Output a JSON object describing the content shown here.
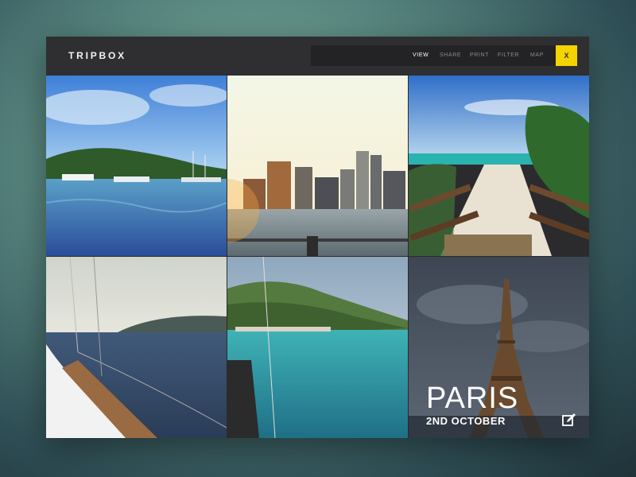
{
  "app": {
    "name": "TRIPBOX"
  },
  "menu": {
    "items": [
      {
        "label": "VIEW",
        "active": true
      },
      {
        "label": "SHARE",
        "active": false
      },
      {
        "label": "PRINT",
        "active": false
      },
      {
        "label": "FILTER",
        "active": false
      },
      {
        "label": "MAP",
        "active": false
      }
    ],
    "close_label": "X"
  },
  "colors": {
    "accent": "#f3d400",
    "titlebar": "#2f2f31",
    "menu_bg": "#232325"
  },
  "photos": [
    {
      "id": "harbor-bay"
    },
    {
      "id": "city-skyline"
    },
    {
      "id": "beach-boardwalk"
    },
    {
      "id": "sailboat-deck"
    },
    {
      "id": "coastal-cove"
    },
    {
      "id": "eiffel-tower",
      "caption": {
        "city": "PARIS",
        "date": "2ND OCTOBER"
      },
      "icon": "edit-icon"
    }
  ]
}
